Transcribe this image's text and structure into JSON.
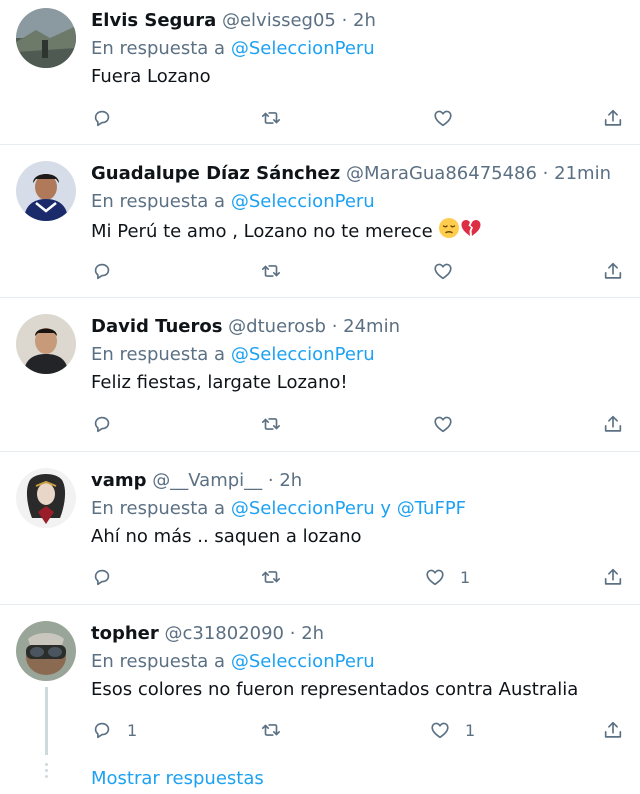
{
  "tweets": [
    {
      "name": "Elvis Segura",
      "handle": "@elvisseg05",
      "sep": " · ",
      "time": "2h",
      "reply_prefix": "En respuesta a ",
      "mentions": "@SeleccionPeru",
      "text": "Fuera Lozano",
      "like_count": "",
      "reply_count": ""
    },
    {
      "name": "Guadalupe Díaz Sánchez",
      "handle": "@MaraGua86475486",
      "sep": " · ",
      "time": "21min",
      "reply_prefix": "En respuesta a ",
      "mentions": "@SeleccionPeru",
      "text": "Mi Perú te amo , Lozano no te merece ",
      "like_count": "",
      "reply_count": ""
    },
    {
      "name": "David Tueros",
      "handle": "@dtuerosb",
      "sep": " · ",
      "time": "24min",
      "reply_prefix": "En respuesta a ",
      "mentions": "@SeleccionPeru",
      "text": "Feliz fiestas, largate Lozano!",
      "like_count": "",
      "reply_count": ""
    },
    {
      "name": "vamp",
      "handle": "@__Vampi__",
      "sep": " · ",
      "time": "2h",
      "reply_prefix": "En respuesta a ",
      "mentions": "@SeleccionPeru y @TuFPF",
      "text": "Ahí no más .. saquen a lozano",
      "like_count": "1",
      "reply_count": ""
    },
    {
      "name": "topher",
      "handle": "@c31802090",
      "sep": " · ",
      "time": "2h",
      "reply_prefix": "En respuesta a ",
      "mentions": "@SeleccionPeru",
      "text": "Esos colores no fueron representados contra Australia",
      "like_count": "1",
      "reply_count": "1"
    }
  ],
  "show_replies": "Mostrar respuestas",
  "icons": {
    "reply": "reply-icon",
    "retweet": "retweet-icon",
    "like": "like-icon",
    "share": "share-icon"
  },
  "colors": {
    "accent": "#1da1f2",
    "secondary_text": "#5b7083",
    "divider": "#e6ecf0"
  }
}
